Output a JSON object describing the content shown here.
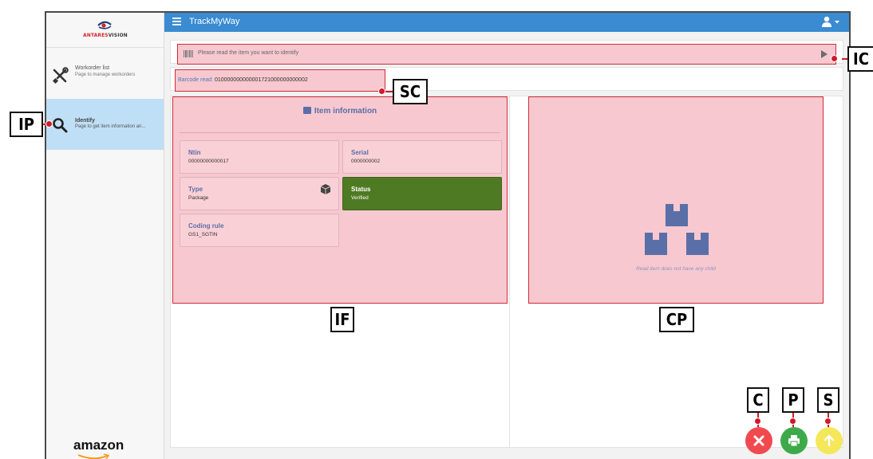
{
  "app": {
    "title": "TrackMyWay"
  },
  "logo": {
    "text_red": "ANTARES",
    "text_dark": "VISION"
  },
  "sidebar": {
    "items": [
      {
        "label": "Workorder list",
        "description": "Page to manage workorders",
        "icon": "tools-icon"
      },
      {
        "label": "Identify",
        "description": "Page to get item information an...",
        "icon": "search-icon",
        "active": true
      }
    ],
    "footer_brand": "amazon"
  },
  "scan": {
    "placeholder": "Please read the item you want to identify"
  },
  "barcode": {
    "label": "Barcode read:",
    "value": "010000000000001721000000000002"
  },
  "item_info": {
    "title": "Item information",
    "fields": {
      "ntin": {
        "label": "Ntin",
        "value": "00000000000017"
      },
      "serial": {
        "label": "Serial",
        "value": "0000000002"
      },
      "type": {
        "label": "Type",
        "value": "Package"
      },
      "status": {
        "label": "Status",
        "value": "Verified"
      },
      "coding_rule": {
        "label": "Coding rule",
        "value": "GS1_SGTIN"
      }
    }
  },
  "children": {
    "empty_text": "Read item does not have any child"
  },
  "annotations": {
    "ic": "IC",
    "sc": "SC",
    "ip": "IP",
    "if": "IF",
    "cp": "CP",
    "c": "C",
    "p": "P",
    "s": "S"
  },
  "colors": {
    "topbar": "#3a8bd1",
    "highlight_fill": "#f7c8cf",
    "highlight_border": "#cf2b37",
    "status_verified": "#4e7a24",
    "cancel": "#f04a4f",
    "print": "#3daa4a",
    "submit": "#f4e75a"
  }
}
